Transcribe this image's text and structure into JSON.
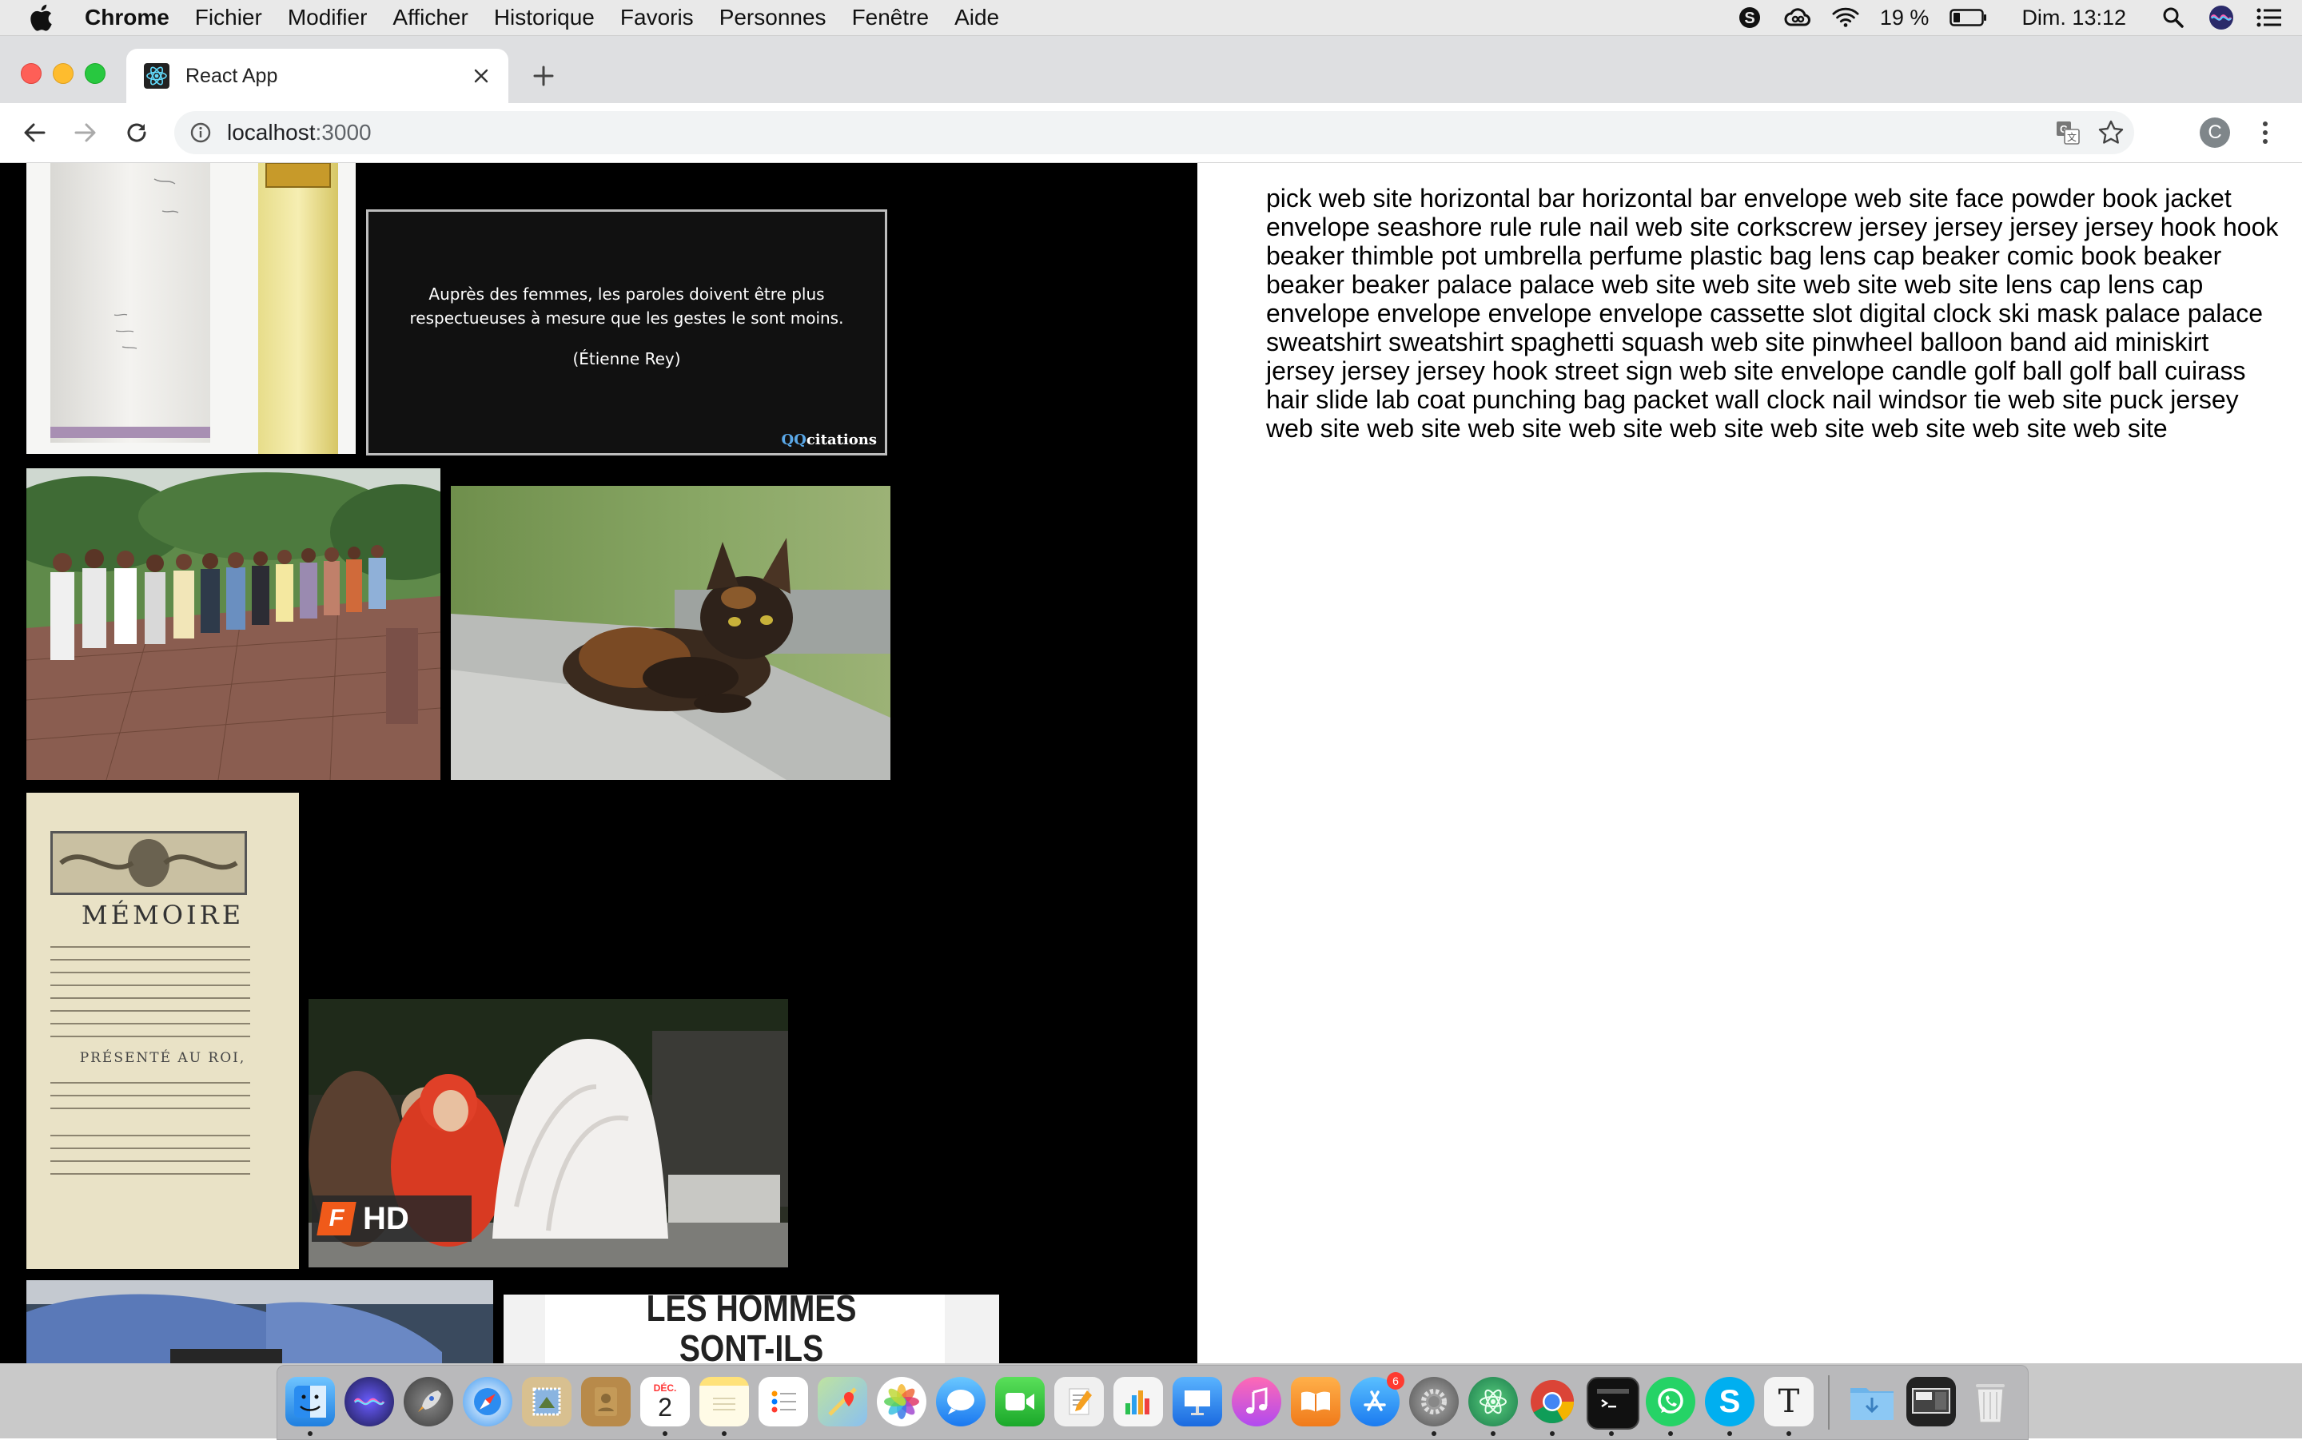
{
  "menubar": {
    "app_name": "Chrome",
    "menus": [
      "Fichier",
      "Modifier",
      "Afficher",
      "Historique",
      "Favoris",
      "Personnes",
      "Fenêtre",
      "Aide"
    ],
    "battery": "19 %",
    "clock": "Dim. 13:12"
  },
  "browser": {
    "tab_title": "React App",
    "url_host": "localhost",
    "url_port": ":3000",
    "profile_initial": "C"
  },
  "gallery": {
    "quote_text": "Auprès des femmes, les paroles doivent être plus respectueuses à mesure que les gestes le sont moins.",
    "quote_author": "(Étienne Rey)",
    "quote_brand_qq": "QQ",
    "quote_brand_word": "citations",
    "memoire_title": "MÉMOIRE",
    "memoire_presented": "PRÉSENTÉ AU ROI,",
    "video_badge": "HD",
    "poster_text_1": "LES HOMMES",
    "poster_text_2": "SONT-ILS"
  },
  "labels_text": "pick web site horizontal bar horizontal bar envelope web site face powder book jacket envelope seashore rule rule nail web site corkscrew jersey jersey jersey jersey hook hook beaker thimble pot umbrella perfume plastic bag lens cap beaker comic book beaker beaker beaker palace palace web site web site web site web site lens cap lens cap envelope envelope envelope envelope cassette slot digital clock ski mask palace palace sweatshirt sweatshirt spaghetti squash web site pinwheel balloon band aid miniskirt jersey jersey jersey hook street sign web site envelope candle golf ball golf ball cuirass hair slide lab coat punching bag packet wall clock nail windsor tie web site puck jersey web site web site web site web site web site web site web site web site web site",
  "dock": {
    "calendar_month": "DÉC.",
    "calendar_day": "2",
    "appstore_badge": "6"
  },
  "colors": {
    "menubar_bg": "#e9e9e9",
    "tabstrip_bg": "#dedfe1",
    "gallery_bg": "#000000",
    "page_bg": "#ffffff"
  }
}
